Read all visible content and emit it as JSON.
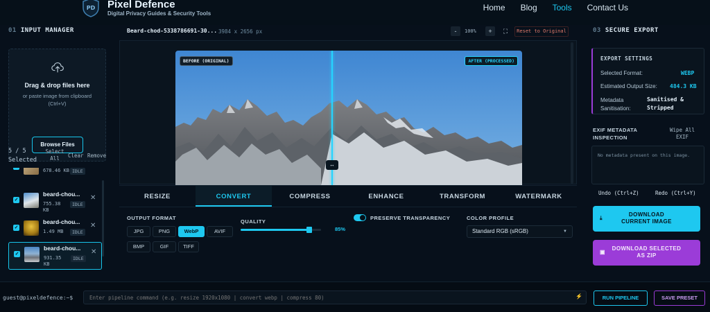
{
  "header": {
    "brand": "Pixel Defence",
    "tagline": "Digital Privacy Guides & Security Tools",
    "nav": [
      {
        "label": "Home"
      },
      {
        "label": "Blog"
      },
      {
        "label": "Tools",
        "active": true
      },
      {
        "label": "Contact Us"
      }
    ]
  },
  "input_manager": {
    "number": "01",
    "title": "INPUT MANAGER",
    "drop_title": "Drag & drop files here",
    "drop_sub": "or paste image from clipboard (Ctrl+V)",
    "browse_label": "Browse Files",
    "selected_count": "5 / 5 Selected",
    "select_all_label": "Select All",
    "clear_label": "Clear",
    "remove_label": "Remove",
    "files": [
      {
        "name": "",
        "size": "678.46 KB",
        "status": "IDLE"
      },
      {
        "name": "beard-chou...",
        "size": "755.38 KB",
        "status": "IDLE"
      },
      {
        "name": "beard-chou...",
        "size": "1.49 MB",
        "status": "IDLE"
      },
      {
        "name": "beard-chou...",
        "size": "931.35 KB",
        "status": "IDLE",
        "active": true
      }
    ]
  },
  "viewer": {
    "filename": "Beard-chod-5338786691-30...",
    "dimensions": "3984 x 2656 px",
    "zoom_minus": "-",
    "zoom_level": "100%",
    "zoom_plus": "+",
    "fit_icon": "fit-screen-icon",
    "reset_label": "Reset to Original",
    "before_label": "BEFORE (ORIGINAL)",
    "after_label": "AFTER (PROCESSED)",
    "divider_position": 0.45,
    "handle_glyph": "↔"
  },
  "tabs": [
    {
      "label": "RESIZE"
    },
    {
      "label": "CONVERT",
      "active": true
    },
    {
      "label": "COMPRESS"
    },
    {
      "label": "ENHANCE"
    },
    {
      "label": "TRANSFORM"
    },
    {
      "label": "WATERMARK"
    }
  ],
  "convert": {
    "format_label": "OUTPUT FORMAT",
    "formats": [
      "JPG",
      "PNG",
      "WebP",
      "AVIF",
      "BMP",
      "GIF",
      "TIFF"
    ],
    "active_format": "WebP",
    "quality_label": "QUALITY",
    "quality_value": 85,
    "quality_text": "85%",
    "transparency_label": "PRESERVE TRANSPARENCY",
    "transparency_on": true,
    "profile_label": "COLOR PROFILE",
    "profile_value": "Standard RGB (sRGB)"
  },
  "secure_export": {
    "number": "03",
    "title": "SECURE EXPORT",
    "settings_title": "EXPORT SETTINGS",
    "format_key": "Selected Format:",
    "format_val": "WEBP",
    "size_key": "Estimated Output Size:",
    "size_val": "484.3 KB",
    "meta_key": "Metadata Sanitisation:",
    "meta_val": "Sanitised & Stripped",
    "exif_title": "EXIF METADATA INSPECTION",
    "wipe_label": "Wipe All EXIF",
    "exif_msg": "No metadata present on this image.",
    "undo_label": "Undo (Ctrl+Z)",
    "redo_label": "Redo (Ctrl+Y)",
    "download_current": "DOWNLOAD CURRENT IMAGE",
    "download_zip": "DOWNLOAD SELECTED AS ZIP"
  },
  "terminal": {
    "prompt": "guest@pixeldefence:~$",
    "placeholder": "Enter pipeline command (e.g. resize 1920x1080 | convert webp | compress 80)",
    "run_label": "RUN PIPELINE",
    "save_label": "SAVE PRESET"
  },
  "colors": {
    "accent": "#1ec8f0",
    "purple": "#9b3cd8",
    "background": "#07101b"
  }
}
